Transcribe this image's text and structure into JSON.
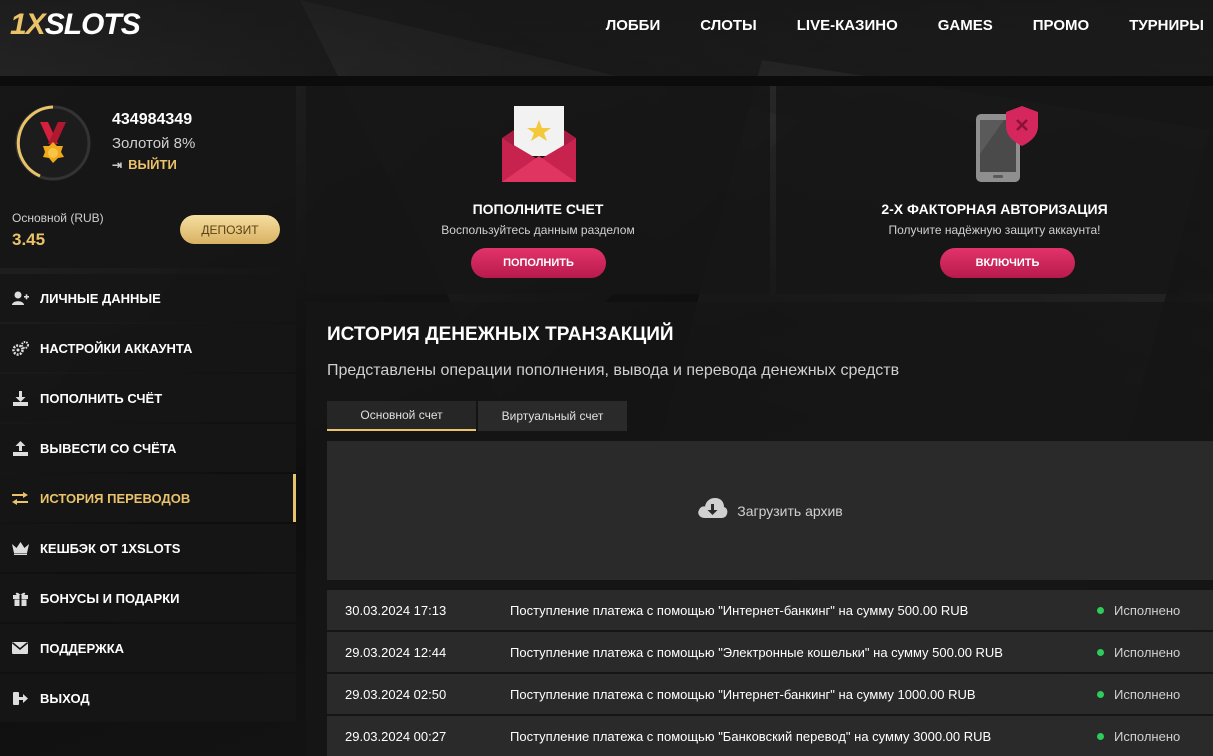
{
  "brand": {
    "logo_part1": "1X",
    "logo_part2": "SLOTS"
  },
  "nav": {
    "items": [
      "ЛОББИ",
      "СЛОТЫ",
      "LIVE-КАЗИНО",
      "GAMES",
      "ПРОМО",
      "ТУРНИРЫ"
    ]
  },
  "profile": {
    "user_id": "434984349",
    "level": "Золотой 8%",
    "logout_label": "ВЫЙТИ",
    "balance_label": "Основной (RUB)",
    "balance_value": "3.45",
    "deposit_label": "ДЕПОЗИТ"
  },
  "menu": {
    "items": [
      {
        "label": "ЛИЧНЫЕ ДАННЫЕ",
        "icon": "user-add-icon"
      },
      {
        "label": "НАСТРОЙКИ АККАУНТА",
        "icon": "gears-icon"
      },
      {
        "label": "ПОПОЛНИТЬ СЧЁТ",
        "icon": "download-icon"
      },
      {
        "label": "ВЫВЕСТИ СО СЧЁТА",
        "icon": "upload-icon"
      },
      {
        "label": "ИСТОРИЯ ПЕРЕВОДОВ",
        "icon": "transfer-icon",
        "active": true
      },
      {
        "label": "КЕШБЭК ОТ 1XSLOTS",
        "icon": "crown-icon"
      },
      {
        "label": "БОНУСЫ И ПОДАРКИ",
        "icon": "gift-icon"
      },
      {
        "label": "ПОДДЕРЖКА",
        "icon": "mail-icon"
      },
      {
        "label": "ВЫХОД",
        "icon": "exit-icon"
      }
    ]
  },
  "cards": {
    "deposit": {
      "title": "ПОПОЛНИТЕ СЧЕТ",
      "desc": "Воспользуйтесь данным разделом",
      "button": "ПОПОЛНИТЬ"
    },
    "twofa": {
      "title": "2-Х ФАКТОРНАЯ АВТОРИЗАЦИЯ",
      "desc": "Получите надёжную защиту аккаунта!",
      "button": "ВКЛЮЧИТЬ"
    }
  },
  "history": {
    "title": "ИСТОРИЯ ДЕНЕЖНЫХ ТРАНЗАКЦИЙ",
    "subtitle": "Представлены операции пополнения, вывода и перевода денежных средств",
    "tabs": [
      "Основной счет",
      "Виртуальный счет"
    ],
    "archive_label": "Загрузить архив",
    "rows": [
      {
        "date": "30.03.2024 17:13",
        "desc": "Поступление платежа с помощью \"Интернет-банкинг\" на сумму 500.00 RUB",
        "status": "Исполнено"
      },
      {
        "date": "29.03.2024 12:44",
        "desc": "Поступление платежа с помощью \"Электронные кошельки\" на сумму 500.00 RUB",
        "status": "Исполнено"
      },
      {
        "date": "29.03.2024 02:50",
        "desc": "Поступление платежа с помощью \"Интернет-банкинг\" на сумму 1000.00 RUB",
        "status": "Исполнено"
      },
      {
        "date": "29.03.2024 00:27",
        "desc": "Поступление платежа с помощью \"Банковский перевод\" на сумму 3000.00 RUB",
        "status": "Исполнено"
      }
    ]
  },
  "colors": {
    "gold": "#e9c26a",
    "pink": "#d6265e",
    "status_ok": "#2ecc5a"
  }
}
